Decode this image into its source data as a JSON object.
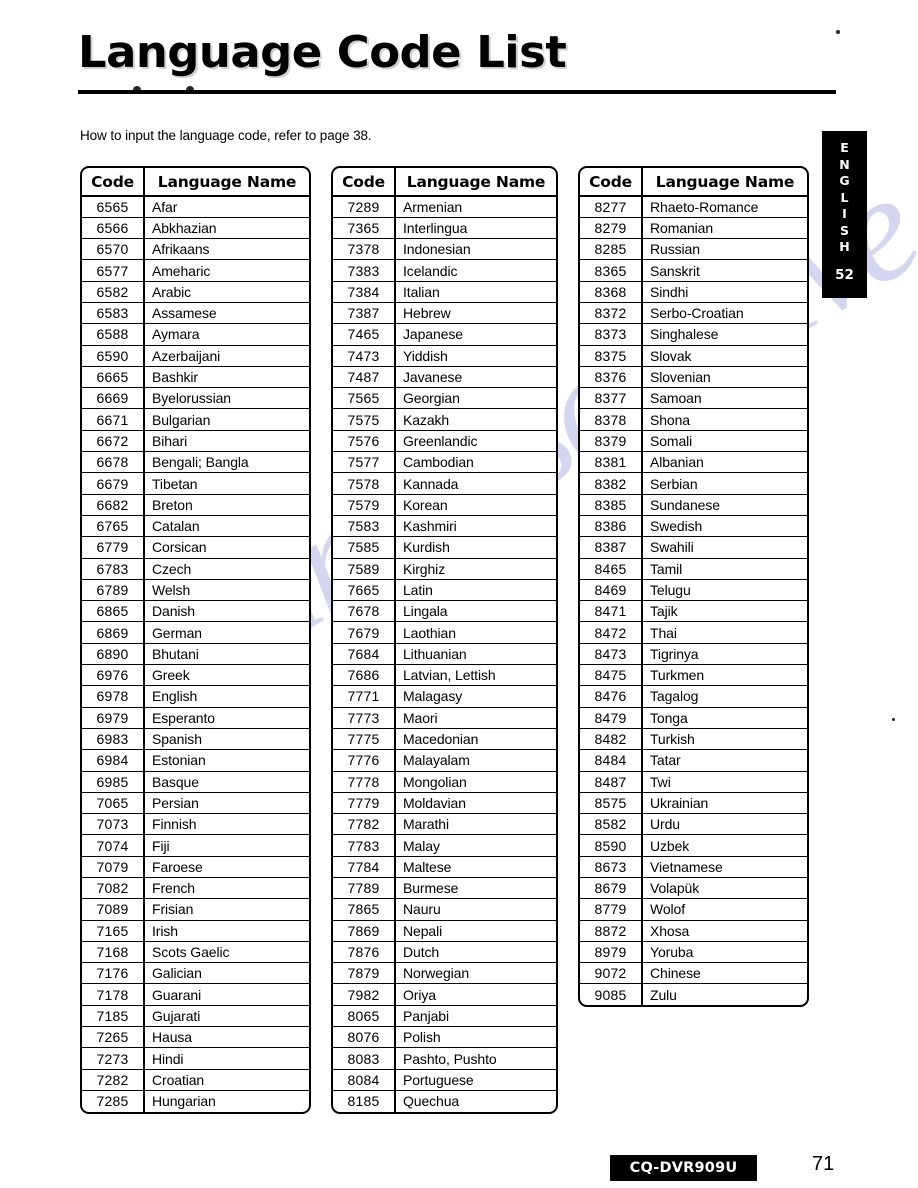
{
  "page": {
    "title": "Language Code List",
    "intro": "How to input the language code, refer to page 38.",
    "watermark": "manualsarchive"
  },
  "side_tab": {
    "letters": [
      "E",
      "N",
      "G",
      "L",
      "I",
      "S",
      "H"
    ],
    "page_number": "52"
  },
  "footer": {
    "model": "CQ-DVR909U",
    "page_number": "71"
  },
  "table": {
    "headers": {
      "code": "Code",
      "name": "Language Name"
    }
  },
  "columns": [
    {
      "id": "col-1",
      "rows": [
        {
          "code": "6565",
          "name": "Afar"
        },
        {
          "code": "6566",
          "name": "Abkhazian"
        },
        {
          "code": "6570",
          "name": "Afrikaans"
        },
        {
          "code": "6577",
          "name": "Ameharic"
        },
        {
          "code": "6582",
          "name": "Arabic"
        },
        {
          "code": "6583",
          "name": "Assamese"
        },
        {
          "code": "6588",
          "name": "Aymara"
        },
        {
          "code": "6590",
          "name": "Azerbaijani"
        },
        {
          "code": "6665",
          "name": "Bashkir"
        },
        {
          "code": "6669",
          "name": "Byelorussian"
        },
        {
          "code": "6671",
          "name": "Bulgarian"
        },
        {
          "code": "6672",
          "name": "Bihari"
        },
        {
          "code": "6678",
          "name": "Bengali; Bangla"
        },
        {
          "code": "6679",
          "name": "Tibetan"
        },
        {
          "code": "6682",
          "name": "Breton"
        },
        {
          "code": "6765",
          "name": "Catalan"
        },
        {
          "code": "6779",
          "name": "Corsican"
        },
        {
          "code": "6783",
          "name": "Czech"
        },
        {
          "code": "6789",
          "name": "Welsh"
        },
        {
          "code": "6865",
          "name": "Danish"
        },
        {
          "code": "6869",
          "name": "German"
        },
        {
          "code": "6890",
          "name": "Bhutani"
        },
        {
          "code": "6976",
          "name": "Greek"
        },
        {
          "code": "6978",
          "name": "English"
        },
        {
          "code": "6979",
          "name": "Esperanto"
        },
        {
          "code": "6983",
          "name": "Spanish"
        },
        {
          "code": "6984",
          "name": "Estonian"
        },
        {
          "code": "6985",
          "name": "Basque"
        },
        {
          "code": "7065",
          "name": "Persian"
        },
        {
          "code": "7073",
          "name": "Finnish"
        },
        {
          "code": "7074",
          "name": "Fiji"
        },
        {
          "code": "7079",
          "name": "Faroese"
        },
        {
          "code": "7082",
          "name": "French"
        },
        {
          "code": "7089",
          "name": "Frisian"
        },
        {
          "code": "7165",
          "name": "Irish"
        },
        {
          "code": "7168",
          "name": "Scots Gaelic"
        },
        {
          "code": "7176",
          "name": "Galician"
        },
        {
          "code": "7178",
          "name": "Guarani"
        },
        {
          "code": "7185",
          "name": "Gujarati"
        },
        {
          "code": "7265",
          "name": "Hausa"
        },
        {
          "code": "7273",
          "name": "Hindi"
        },
        {
          "code": "7282",
          "name": "Croatian"
        },
        {
          "code": "7285",
          "name": "Hungarian"
        }
      ]
    },
    {
      "id": "col-2",
      "rows": [
        {
          "code": "7289",
          "name": "Armenian"
        },
        {
          "code": "7365",
          "name": "Interlingua"
        },
        {
          "code": "7378",
          "name": "Indonesian"
        },
        {
          "code": "7383",
          "name": "Icelandic"
        },
        {
          "code": "7384",
          "name": "Italian"
        },
        {
          "code": "7387",
          "name": "Hebrew"
        },
        {
          "code": "7465",
          "name": "Japanese"
        },
        {
          "code": "7473",
          "name": "Yiddish"
        },
        {
          "code": "7487",
          "name": "Javanese"
        },
        {
          "code": "7565",
          "name": "Georgian"
        },
        {
          "code": "7575",
          "name": "Kazakh"
        },
        {
          "code": "7576",
          "name": "Greenlandic"
        },
        {
          "code": "7577",
          "name": "Cambodian"
        },
        {
          "code": "7578",
          "name": "Kannada"
        },
        {
          "code": "7579",
          "name": "Korean"
        },
        {
          "code": "7583",
          "name": "Kashmiri"
        },
        {
          "code": "7585",
          "name": "Kurdish"
        },
        {
          "code": "7589",
          "name": "Kirghiz"
        },
        {
          "code": "7665",
          "name": "Latin"
        },
        {
          "code": "7678",
          "name": "Lingala"
        },
        {
          "code": "7679",
          "name": "Laothian"
        },
        {
          "code": "7684",
          "name": "Lithuanian"
        },
        {
          "code": "7686",
          "name": "Latvian, Lettish"
        },
        {
          "code": "7771",
          "name": "Malagasy"
        },
        {
          "code": "7773",
          "name": "Maori"
        },
        {
          "code": "7775",
          "name": "Macedonian"
        },
        {
          "code": "7776",
          "name": "Malayalam"
        },
        {
          "code": "7778",
          "name": "Mongolian"
        },
        {
          "code": "7779",
          "name": "Moldavian"
        },
        {
          "code": "7782",
          "name": "Marathi"
        },
        {
          "code": "7783",
          "name": "Malay"
        },
        {
          "code": "7784",
          "name": "Maltese"
        },
        {
          "code": "7789",
          "name": "Burmese"
        },
        {
          "code": "7865",
          "name": "Nauru"
        },
        {
          "code": "7869",
          "name": "Nepali"
        },
        {
          "code": "7876",
          "name": "Dutch"
        },
        {
          "code": "7879",
          "name": "Norwegian"
        },
        {
          "code": "7982",
          "name": "Oriya"
        },
        {
          "code": "8065",
          "name": "Panjabi"
        },
        {
          "code": "8076",
          "name": "Polish"
        },
        {
          "code": "8083",
          "name": "Pashto, Pushto"
        },
        {
          "code": "8084",
          "name": "Portuguese"
        },
        {
          "code": "8185",
          "name": "Quechua"
        }
      ]
    },
    {
      "id": "col-3",
      "rows": [
        {
          "code": "8277",
          "name": "Rhaeto-Romance"
        },
        {
          "code": "8279",
          "name": "Romanian"
        },
        {
          "code": "8285",
          "name": "Russian"
        },
        {
          "code": "8365",
          "name": "Sanskrit"
        },
        {
          "code": "8368",
          "name": "Sindhi"
        },
        {
          "code": "8372",
          "name": "Serbo-Croatian"
        },
        {
          "code": "8373",
          "name": "Singhalese"
        },
        {
          "code": "8375",
          "name": "Slovak"
        },
        {
          "code": "8376",
          "name": "Slovenian"
        },
        {
          "code": "8377",
          "name": "Samoan"
        },
        {
          "code": "8378",
          "name": "Shona"
        },
        {
          "code": "8379",
          "name": "Somali"
        },
        {
          "code": "8381",
          "name": "Albanian"
        },
        {
          "code": "8382",
          "name": "Serbian"
        },
        {
          "code": "8385",
          "name": "Sundanese"
        },
        {
          "code": "8386",
          "name": "Swedish"
        },
        {
          "code": "8387",
          "name": "Swahili"
        },
        {
          "code": "8465",
          "name": "Tamil"
        },
        {
          "code": "8469",
          "name": "Telugu"
        },
        {
          "code": "8471",
          "name": "Tajik"
        },
        {
          "code": "8472",
          "name": "Thai"
        },
        {
          "code": "8473",
          "name": "Tigrinya"
        },
        {
          "code": "8475",
          "name": "Turkmen"
        },
        {
          "code": "8476",
          "name": "Tagalog"
        },
        {
          "code": "8479",
          "name": "Tonga"
        },
        {
          "code": "8482",
          "name": "Turkish"
        },
        {
          "code": "8484",
          "name": "Tatar"
        },
        {
          "code": "8487",
          "name": "Twi"
        },
        {
          "code": "8575",
          "name": "Ukrainian"
        },
        {
          "code": "8582",
          "name": "Urdu"
        },
        {
          "code": "8590",
          "name": "Uzbek"
        },
        {
          "code": "8673",
          "name": "Vietnamese"
        },
        {
          "code": "8679",
          "name": "Volapük"
        },
        {
          "code": "8779",
          "name": "Wolof"
        },
        {
          "code": "8872",
          "name": "Xhosa"
        },
        {
          "code": "8979",
          "name": "Yoruba"
        },
        {
          "code": "9072",
          "name": "Chinese"
        },
        {
          "code": "9085",
          "name": "Zulu"
        }
      ]
    }
  ]
}
